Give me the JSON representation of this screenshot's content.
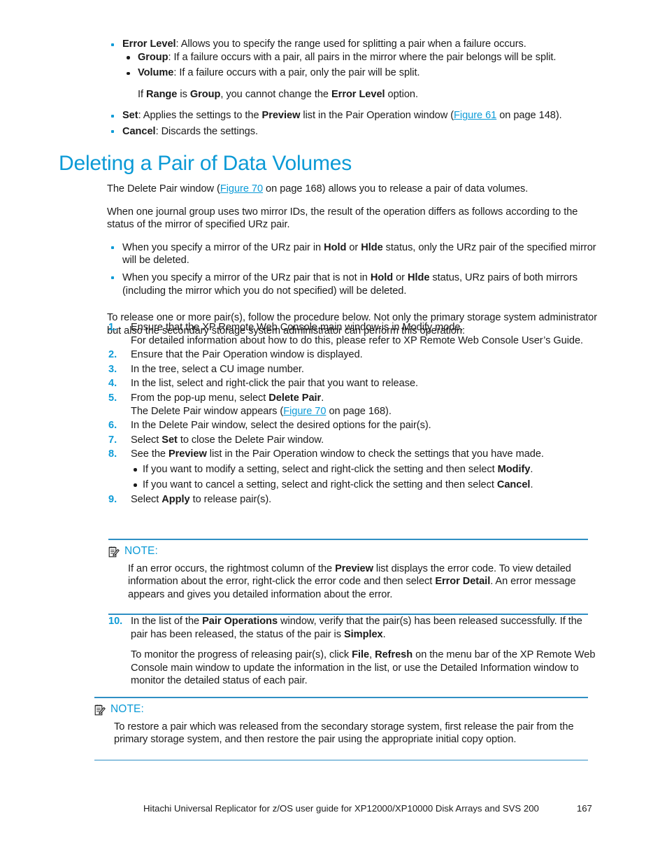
{
  "page": {
    "footer_text": "Hitachi Universal Replicator for z/OS user guide for XP12000/XP10000 Disk Arrays and SVS 200",
    "page_number": "167"
  },
  "colors": {
    "accent_blue": "#0b9ad6",
    "link_blue": "#0d9bd7",
    "rule_blue": "#2f8fc4",
    "body_text": "#1a1a1a"
  },
  "top_bullets": {
    "error_level": {
      "term": "Error Level",
      "rest": ":  Allows you to specify the range used for splitting a pair when a failure occurs.",
      "sub": [
        {
          "term": "Group",
          "rest": ":  If a failure occurs with a pair, all pairs in the mirror where the pair belongs will be split."
        },
        {
          "term": "Volume",
          "rest": ":  If a failure occurs with a pair, only the pair will be split."
        }
      ],
      "note_line": {
        "pre": "If ",
        "b1": "Range",
        "mid1": " is ",
        "b2": "Group",
        "mid2": ", you cannot change the ",
        "b3": "Error Level",
        "post": " option."
      }
    },
    "set": {
      "term": "Set",
      "rest_a": ":  Applies the settings to the ",
      "bold_preview": "Preview",
      "rest_b": " list in the Pair Operation window (",
      "link": "Figure 61",
      "rest_c": " on page 148)."
    },
    "cancel": {
      "term": "Cancel",
      "rest": ":  Discards the settings."
    }
  },
  "heading": "Deleting a Pair of Data Volumes",
  "intro": {
    "p1_a": "The Delete Pair window (",
    "p1_link": "Figure 70",
    "p1_b": " on page 168) allows you to release a pair of data volumes.",
    "p2": "When one journal group uses two mirror IDs, the result of the operation differs as follows according to the status of the mirror of specified URz pair.",
    "bullets": [
      {
        "a": "When you specify a mirror of the URz pair in ",
        "b1": "Hold",
        "mid": " or ",
        "b2": "Hlde",
        "c": " status, only the URz pair of the specified mirror will be deleted."
      },
      {
        "a": "When you specify a mirror of the URz pair that is not in ",
        "b1": "Hold",
        "mid": " or ",
        "b2": "Hlde",
        "c": " status, URz pairs of both mirrors (including the mirror which you do not specified) will be deleted."
      }
    ],
    "p3": "To release one or more pair(s), follow the procedure below.  Not only the primary storage system administrator but also the secondary storage system administrator can perform this operation:"
  },
  "steps": {
    "s1": {
      "num": "1.",
      "text": "Ensure that the XP Remote Web Console main window is in Modify mode.",
      "sub": "For detailed information about how to do this, please refer to XP Remote Web Console User’s Guide."
    },
    "s2": {
      "num": "2.",
      "text": "Ensure that the Pair Operation window is displayed."
    },
    "s3": {
      "num": "3.",
      "text": "In the tree, select a CU image number."
    },
    "s4": {
      "num": "4.",
      "text": "In the list, select and right-click the pair that you want to release."
    },
    "s5": {
      "num": "5.",
      "a": "From the pop-up menu, select ",
      "b": "Delete Pair",
      "c": ".",
      "sub_a": "The Delete Pair window appears (",
      "sub_link": "Figure 70",
      "sub_b": " on page 168)."
    },
    "s6": {
      "num": "6.",
      "text": "In the Delete Pair window, select the desired options for the pair(s)."
    },
    "s7": {
      "num": "7.",
      "a": "Select ",
      "b": "Set",
      "c": " to close the Delete Pair window."
    },
    "s8": {
      "num": "8.",
      "a": "See the ",
      "b": "Preview",
      "c": " list in the Pair Operation window to check the settings that you have made.",
      "sub": [
        {
          "a": "If you want to modify a setting, select and right-click the setting and then select ",
          "b": "Modify",
          "c": "."
        },
        {
          "a": "If you want to cancel a setting, select and right-click the setting and then select ",
          "b": "Cancel",
          "c": "."
        }
      ]
    },
    "s9": {
      "num": "9.",
      "a": "Select ",
      "b": "Apply",
      "c": " to release pair(s)."
    },
    "s10": {
      "num": "10.",
      "a": "In the list of the ",
      "b": "Pair Operations",
      "c": " window, verify that the pair(s) has been released successfully.  If the pair has been released, the status of the pair is ",
      "d": "Simplex",
      "e": ".",
      "sub_a": "To monitor the progress of releasing pair(s), click ",
      "sub_b1": "File",
      "sub_mid": ", ",
      "sub_b2": "Refresh",
      "sub_c": " on the menu bar of the XP Remote Web Console main window to update the information in the list, or use the Detailed Information window to monitor the detailed status of each pair."
    }
  },
  "note1": {
    "label": "NOTE:",
    "icon": "note-pencil-icon",
    "a": "If an error occurs, the rightmost column of the ",
    "b1": "Preview",
    "mid": " list displays the error code. To view detailed information about the error, right-click the error code and then select ",
    "b2": "Error Detail",
    "c": ". An error message appears and gives you detailed information about the error."
  },
  "note2": {
    "label": "NOTE:",
    "icon": "note-pencil-icon",
    "text": "To restore a pair which was released from the secondary storage system, first release the pair from the primary storage system, and then restore the pair using the appropriate initial copy option."
  }
}
